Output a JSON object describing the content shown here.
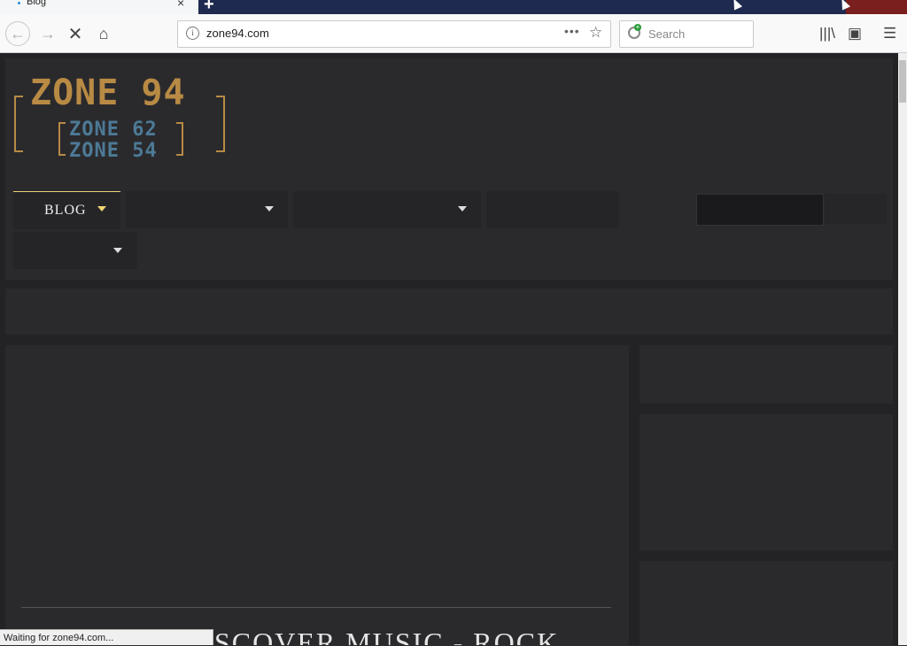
{
  "tab": {
    "title": "Blog",
    "close": "×",
    "new_tab": "+"
  },
  "toolbar": {
    "back": "←",
    "forward": "→",
    "stop": "✕",
    "home": "⌂",
    "url": "zone94.com",
    "page_actions": "•••",
    "bookmark": "☆",
    "search_placeholder": "Search",
    "library": "|||\\",
    "sidebar": "▣",
    "menu": "☰"
  },
  "logo": {
    "main": "ZONE 94",
    "sub1": "ZONE 62",
    "sub2": "ZONE 54"
  },
  "nav": {
    "blog_label": "BLOG"
  },
  "main": {
    "headline": "SCOVER MUSIC - ROCK"
  },
  "status": {
    "text": "Waiting for zone94.com..."
  },
  "colors": {
    "brand_gold": "#b88a44",
    "brand_blue": "#4d7a96",
    "accent_yellow": "#f0d572",
    "page_bg": "#232326"
  },
  "icons": [
    "info-icon",
    "page-actions-icon",
    "bookmark-star-icon",
    "search-icon",
    "library-icon",
    "sidebar-icon",
    "menu-icon",
    "back-arrow-icon",
    "forward-arrow-icon",
    "stop-icon",
    "home-icon"
  ]
}
